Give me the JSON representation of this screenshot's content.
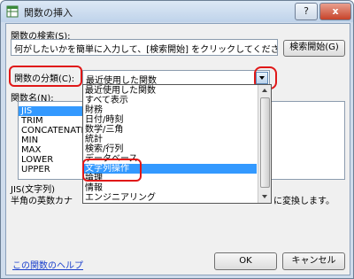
{
  "window": {
    "title": "関数の挿入",
    "help_button": "?",
    "close_button": "x"
  },
  "search": {
    "label": "関数の検索(S):",
    "value": "何がしたいかを簡単に入力して、[検索開始] をクリックしてください。",
    "button": "検索開始(G)"
  },
  "category": {
    "label": "関数の分類(C):",
    "value": "最近使用した関数"
  },
  "function_list": {
    "label": "関数名(N):",
    "selected": "JIS",
    "items": [
      "JIS",
      "TRIM",
      "CONCATENATE",
      "MIN",
      "MAX",
      "LOWER",
      "UPPER"
    ]
  },
  "dropdown": {
    "items": [
      "最近使用した関数",
      "すべて表示",
      "財務",
      "日付/時刻",
      "数学/三角",
      "統計",
      "検索/行列",
      "データベース",
      "文字列操作",
      "論理",
      "情報",
      "エンジニアリング"
    ],
    "selected": "文字列操作"
  },
  "description": {
    "syntax": "JIS(文字列)",
    "text": "半角の英数カナ",
    "text_end": "に変換します。"
  },
  "footer": {
    "help_link": "この関数のヘルプ",
    "ok": "OK",
    "cancel": "キャンセル"
  },
  "colors": {
    "highlight": "#3399ff",
    "annotation": "#e01818"
  }
}
